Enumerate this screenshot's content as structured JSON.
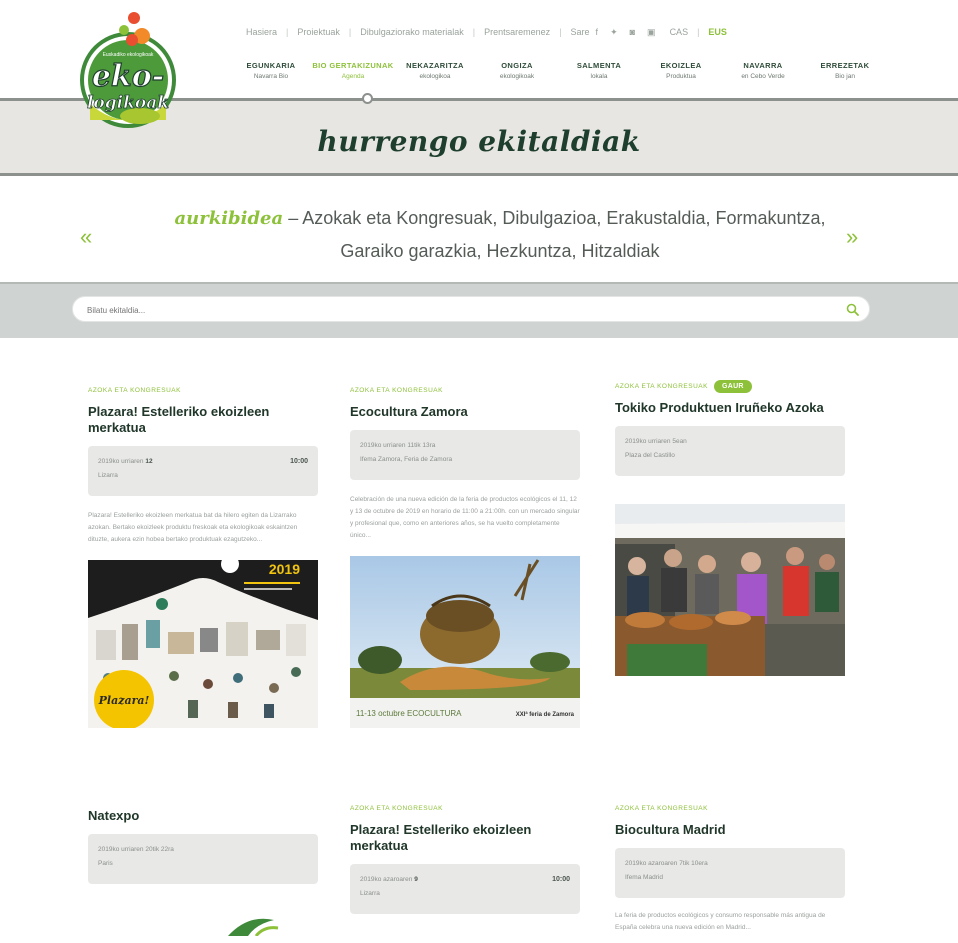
{
  "logo": {
    "main_text": "eko-logikoak",
    "ring_text": "Euskadiko ekologikoak"
  },
  "top_nav": {
    "items": [
      "Hasiera",
      "Proiektuak",
      "Dibulgaziorako materialak",
      "Prentsaremenez",
      "Sare"
    ],
    "social_icons": [
      "facebook-icon",
      "twitter-icon",
      "instagram-icon",
      "youtube-icon"
    ],
    "languages": [
      "CAS",
      "EUS"
    ],
    "active_language": "EUS"
  },
  "main_nav": [
    {
      "title": "EGUNKARIA",
      "sub": "Navarra Bio"
    },
    {
      "title": "BIO GERTAKIZUNAK",
      "sub": "Agenda",
      "active": true
    },
    {
      "title": "NEKAZARITZA",
      "sub": "ekologikoa"
    },
    {
      "title": "ONGIZA",
      "sub": "ekologikoak"
    },
    {
      "title": "SALMENTA",
      "sub": "lokala"
    },
    {
      "title": "EKOIZLEA",
      "sub": "Produktua"
    },
    {
      "title": "NAVARRA",
      "sub": "en Cebo Verde"
    },
    {
      "title": "ERREZETAK",
      "sub": "Bio jan"
    }
  ],
  "hero": {
    "title": "hurrengo ekitaldiak"
  },
  "categories": {
    "prev_arrow": "«",
    "next_arrow": "»",
    "highlight": "aurkibidea",
    "dash": "–",
    "text": "Azokak eta Kongresuak, Dibulgazioa, Erakustaldia, Formakuntza, Garaiko garazkia, Hezkuntza, Hitzaldiak"
  },
  "search": {
    "placeholder": "Bilatu ekitaldia..."
  },
  "colors": {
    "accent": "#8dc13a",
    "dark_green": "#1f3f2e",
    "band_grey": "#e7e6e2"
  },
  "cards": [
    {
      "category": "AZOKA ETA KONGRESUAK",
      "title": "Plazara! Estelleriko ekoizleen merkatua",
      "info_date": "2019ko urriaren",
      "info_day": "12",
      "info_place": "Lizarra",
      "time": "10:00",
      "desc": "Plazara! Estelleriko ekoizleen merkatua bat da hilero egiten da Lizarrako azokan. Bertako ekoizleek produktu freskoak eta ekologikoak eskaintzen dituzte, aukera ezin hobea bertako produktuak ezagutzeko...",
      "image_label": "2019",
      "image_brand": "Plazara!"
    },
    {
      "category": "AZOKA ETA KONGRESUAK",
      "title": "Ecocultura Zamora",
      "info_date": "2019ko urriaren 11tik 13ra",
      "info_place": "Ifema Zamora, Feria de Zamora",
      "desc": "Celebración de una nueva edición de la feria de productos ecológicos el 11, 12 y 13 de octubre de 2019 en horario de 11:00 a 21:00h. con un mercado singular y profesional que, como en anteriores años, se ha vuelto completamente único...",
      "image_caption": "11-13 octubre ECOCULTURA",
      "image_caption_extra": "XXIª feria de Zamora"
    },
    {
      "category": "AZOKA ETA KONGRESUAK",
      "badge": "GAUR",
      "title": "Tokiko Produktuen Iruñeko Azoka",
      "info_date": "2019ko urriaren 5ean",
      "info_place": "Plaza del Castillo"
    },
    {
      "category": "",
      "title": "Natexpo",
      "info_date": "2019ko urriaren 20tik 22ra",
      "info_place": "Paris"
    },
    {
      "category": "AZOKA ETA KONGRESUAK",
      "title": "Plazara! Estelleriko ekoizleen merkatua",
      "info_date": "2019ko azaroaren",
      "info_day": "9",
      "info_place": "Lizarra",
      "time": "10:00"
    },
    {
      "category": "AZOKA ETA KONGRESUAK",
      "title": "Biocultura Madrid",
      "info_date": "2019ko azaroaren 7tik 10era",
      "info_place": "Ifema Madrid",
      "desc": "La feria de productos ecológicos y consumo responsable más antigua de España celebra una nueva edición en Madrid..."
    }
  ]
}
